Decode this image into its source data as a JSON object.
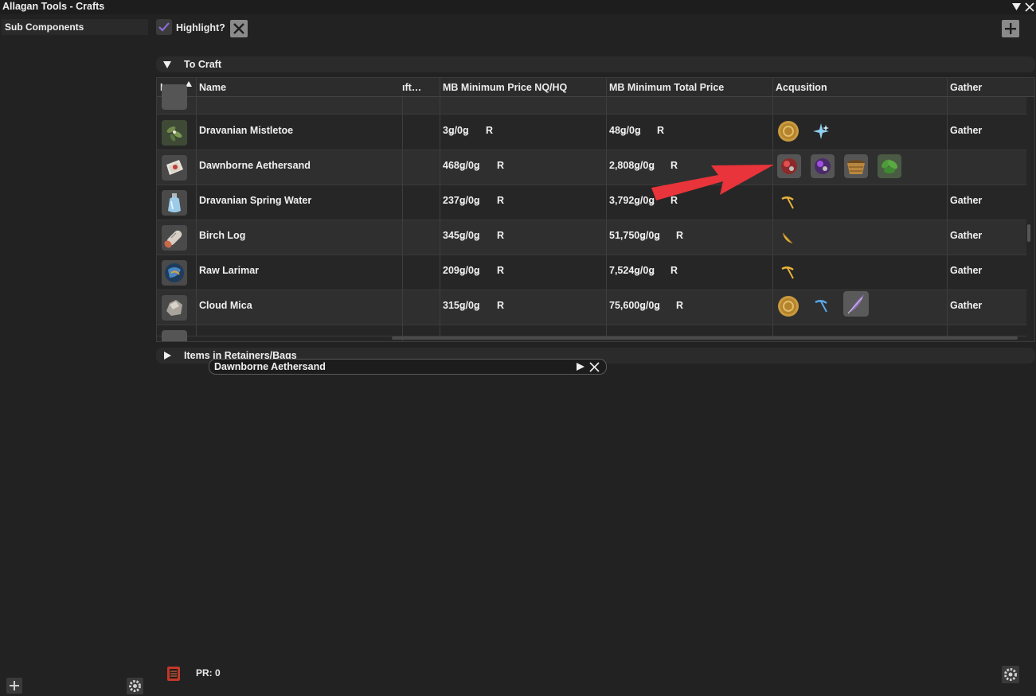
{
  "window": {
    "title": "Allagan Tools - Crafts"
  },
  "sidebar": {
    "items": [
      {
        "label": "Sub Components"
      }
    ]
  },
  "toolbar": {
    "highlight_label": "Highlight?"
  },
  "sections": {
    "to_craft": "To Craft",
    "retainers": "Items in Retainers/Bags"
  },
  "table": {
    "columns": [
      "Icon",
      "Name",
      "ıft…",
      "MB Minimum Price NQ/HQ",
      "MB Minimum Total Price",
      "Acqusition",
      "Gather"
    ],
    "rows": [
      {
        "name": "Dravanian Mistletoe",
        "price": "3ǥ/0ǥ",
        "price_flag": "R",
        "total": "48ǥ/0ǥ",
        "total_flag": "R",
        "gather": "Gather",
        "acq": [
          "gil-coin-icon",
          "sparkle-icon"
        ]
      },
      {
        "name": "Dawnborne Aethersand",
        "price": "468ǥ/0ǥ",
        "price_flag": "R",
        "total": "2,808ǥ/0ǥ",
        "total_flag": "R",
        "gather": "",
        "acq": [
          "reduction-red-icon",
          "reduction-purple-icon",
          "basket-icon",
          "leaf-icon"
        ]
      },
      {
        "name": "Dravanian Spring Water",
        "price": "237ǥ/0ǥ",
        "price_flag": "R",
        "total": "3,792ǥ/0ǥ",
        "total_flag": "R",
        "gather": "Gather",
        "acq": [
          "pickaxe-icon"
        ]
      },
      {
        "name": "Birch Log",
        "price": "345ǥ/0ǥ",
        "price_flag": "R",
        "total": "51,750ǥ/0ǥ",
        "total_flag": "R",
        "gather": "Gather",
        "acq": [
          "hatchet-icon"
        ]
      },
      {
        "name": "Raw Larimar",
        "price": "209ǥ/0ǥ",
        "price_flag": "R",
        "total": "7,524ǥ/0ǥ",
        "total_flag": "R",
        "gather": "Gather",
        "acq": [
          "pickaxe-icon"
        ]
      },
      {
        "name": "Cloud Mica",
        "price": "315ǥ/0ǥ",
        "price_flag": "R",
        "total": "75,600ǥ/0ǥ",
        "total_flag": "R",
        "gather": "Gather",
        "acq": [
          "gil-coin-icon",
          "blue-pickaxe-icon",
          "feather-quill-icon"
        ]
      }
    ]
  },
  "search_popup": {
    "value": "Dawnborne Aethersand"
  },
  "footer": {
    "pr_text": "PR: 0"
  },
  "colors": {
    "background": "#222222",
    "accent_check": "#8a6cd6",
    "annotation_arrow": "#e8343a"
  }
}
